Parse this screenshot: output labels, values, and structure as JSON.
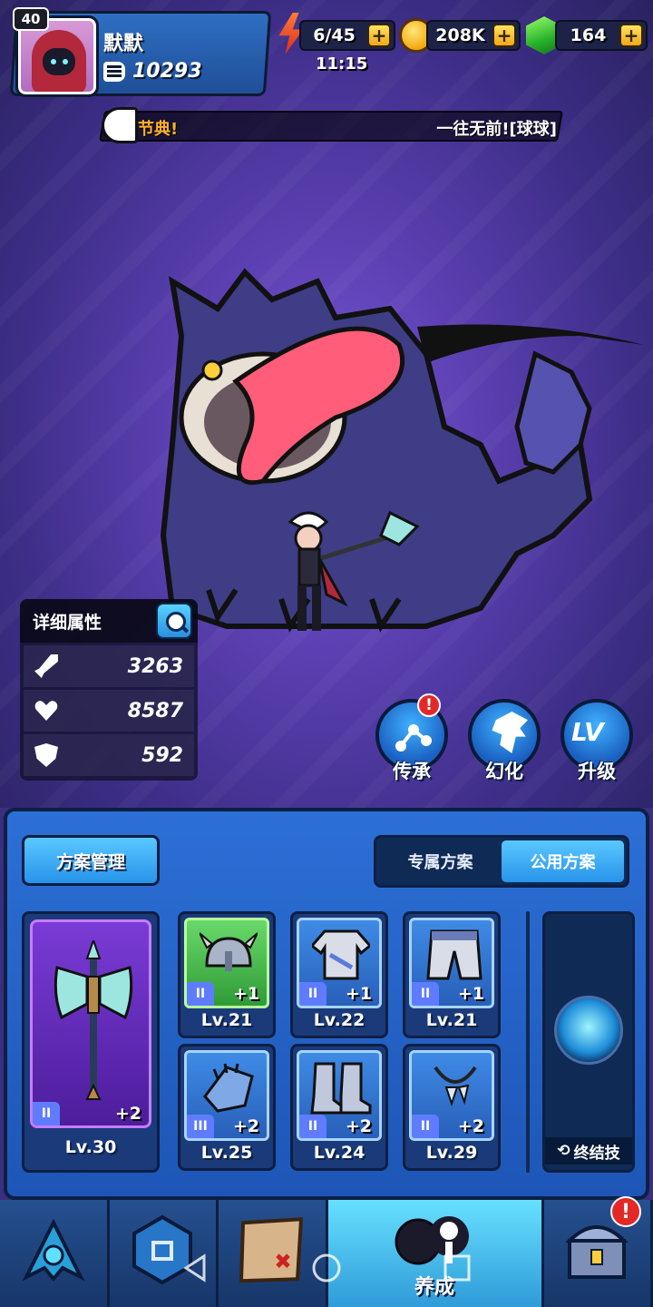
{
  "player": {
    "level": "40",
    "name": "默默",
    "power": "10293"
  },
  "resources": {
    "energy": "6/45",
    "timer": "11:15",
    "coins": "208K",
    "gems": "164",
    "plus": "+"
  },
  "ticker": {
    "prefix": "节典!",
    "message": "一往无前![球球]"
  },
  "stats": {
    "title": "详细属性",
    "attack": "3263",
    "health": "8587",
    "defense": "592"
  },
  "actions": {
    "inherit_label": "传承",
    "inherit_alert": "!",
    "phantom_label": "幻化",
    "upgrade_label": "升级",
    "upgrade_icon_text": "LV"
  },
  "equipment": {
    "scheme_button": "方案管理",
    "tabs": [
      {
        "label": "专属方案",
        "active": false
      },
      {
        "label": "公用方案",
        "active": true
      }
    ],
    "weapon": {
      "grade": "II",
      "plus": "+2",
      "level": "Lv.30"
    },
    "slots": [
      {
        "name": "helmet",
        "grade": "II",
        "plus": "+1",
        "level": "Lv.21"
      },
      {
        "name": "armor",
        "grade": "II",
        "plus": "+1",
        "level": "Lv.22"
      },
      {
        "name": "pants",
        "grade": "II",
        "plus": "+1",
        "level": "Lv.21"
      },
      {
        "name": "gauntlet",
        "grade": "III",
        "plus": "+2",
        "level": "Lv.25"
      },
      {
        "name": "boots",
        "grade": "II",
        "plus": "+2",
        "level": "Lv.24"
      },
      {
        "name": "necklace",
        "grade": "II",
        "plus": "+2",
        "level": "Lv.29"
      }
    ],
    "ultimate_label": "终结技"
  },
  "nav": {
    "items": [
      "hero",
      "gem",
      "map",
      "train",
      "shop"
    ],
    "active_label": "养成",
    "shop_alert": "!"
  },
  "colors": {
    "panel_blue": "#2c6fd6",
    "accent_cyan": "#59c8ff",
    "alert_red": "#e42828",
    "stage_purple": "#5a3fb0"
  }
}
